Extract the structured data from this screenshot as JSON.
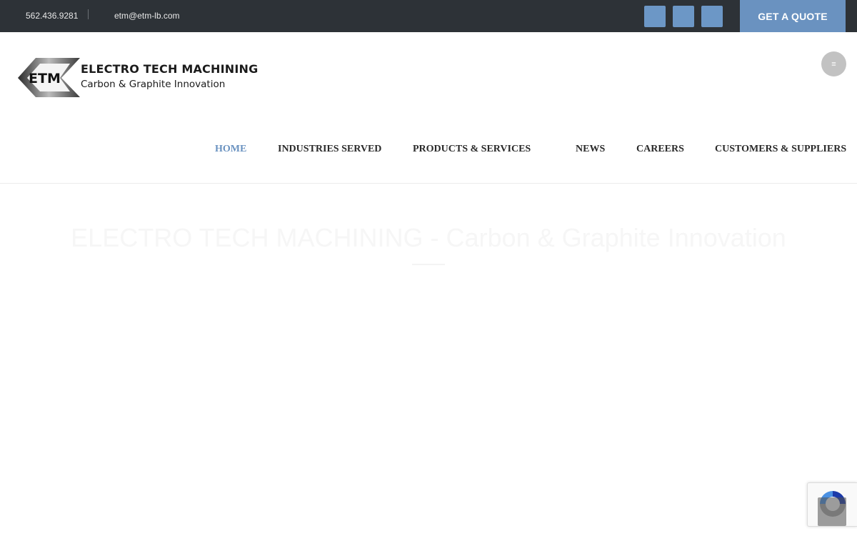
{
  "topbar": {
    "phone": "562.436.9281",
    "email": "etm@etm-lb.com",
    "social_icons": [
      "social-icon-1",
      "social-icon-2",
      "social-icon-3"
    ],
    "quote_label": "GET A QUOTE"
  },
  "logo": {
    "mark": "ETM",
    "brand": "ELECTRO TECH MACHINING",
    "tagline": "Carbon & Graphite Innovation"
  },
  "header": {
    "menu_toggle_icon": "hamburger-icon"
  },
  "nav": {
    "items": [
      {
        "label": "HOME",
        "active": true
      },
      {
        "label": "INDUSTRIES SERVED",
        "active": false
      },
      {
        "label": "PRODUCTS & SERVICES",
        "active": false
      },
      {
        "label": "NEWS",
        "active": false
      },
      {
        "label": "CAREERS",
        "active": false
      },
      {
        "label": "CUSTOMERS & SUPPLIERS",
        "active": false
      }
    ]
  },
  "hero": {
    "title": "ELECTRO TECH MACHINING - Carbon & Graphite Innovation"
  },
  "colors": {
    "topbar_bg": "#2d3237",
    "accent": "#6a92c0",
    "nav_text": "#2a2a2a"
  }
}
